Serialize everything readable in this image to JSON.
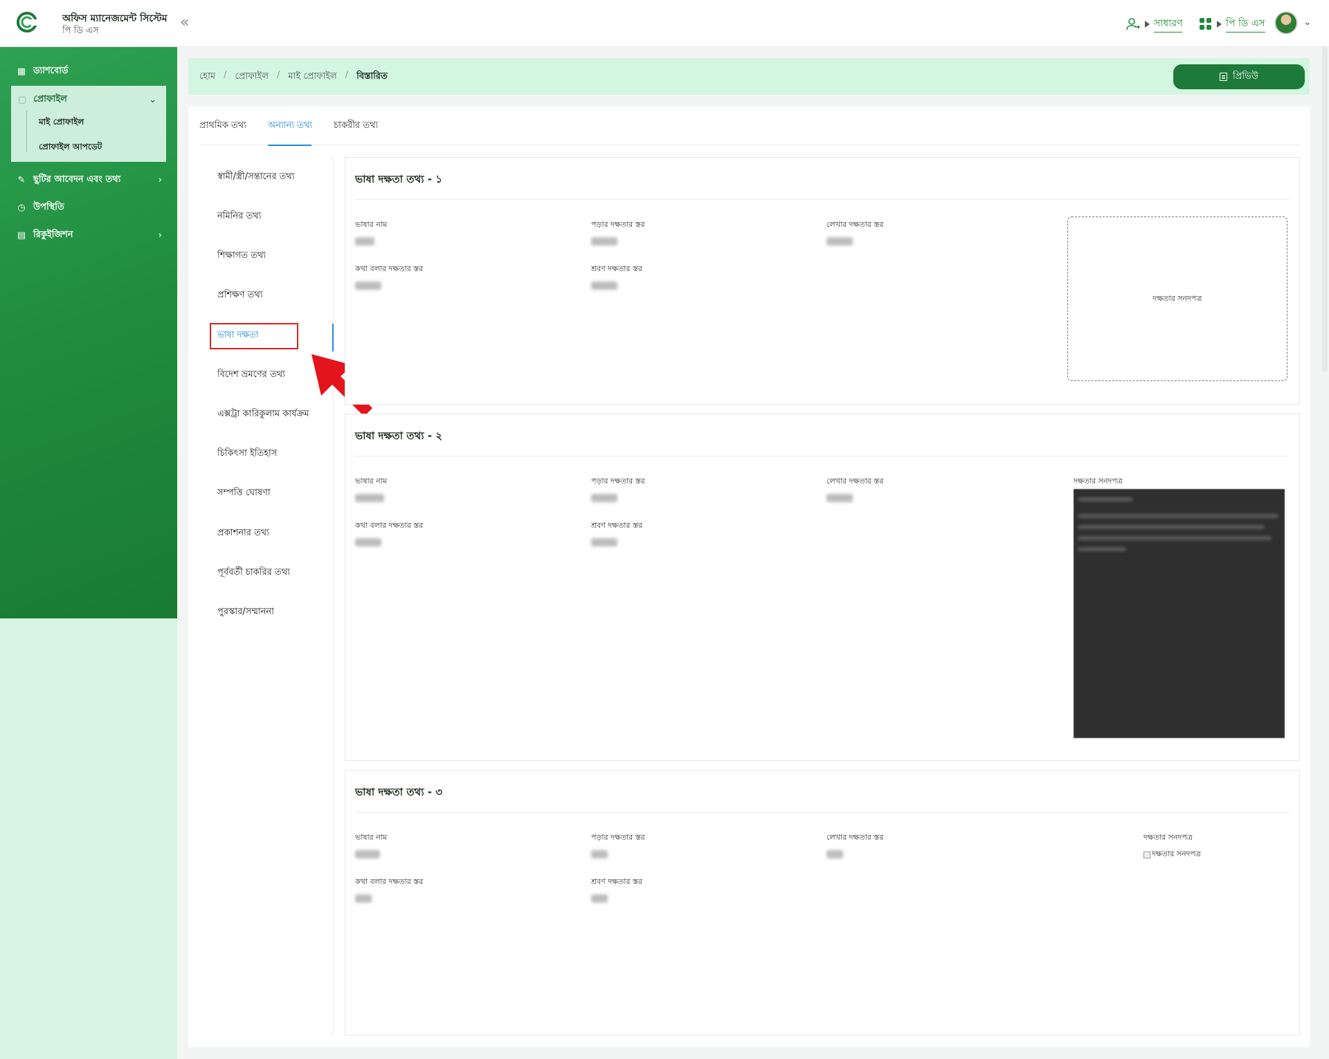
{
  "header": {
    "app_title": "অফিস ম্যানেজমেন্ট সিস্টেম",
    "app_subtitle": "পি ডি এস",
    "role_label": "সাধারণ",
    "module_label": "পি ডি এস"
  },
  "sidebar": {
    "dashboard": "ড্যাশবোর্ড",
    "profile": "প্রোফাইল",
    "my_profile": "মাই প্রোফাইল",
    "profile_update": "প্রোফাইল আপডেট",
    "leave": "ছুটির আবেদন এবং তথ্য",
    "attendance": "উপস্থিতি",
    "requisition": "রিকুইজিশন"
  },
  "breadcrumb": {
    "home": "হোম",
    "profile": "প্রোফাইল",
    "my_profile": "মাই প্রোফাইল",
    "details": "বিস্তারিত"
  },
  "preview_button": "প্রিভিউ",
  "tabs": [
    "প্রাথমিক তথ্য",
    "অন্যান্য তথ্য",
    "চাকরীর তথ্য"
  ],
  "subnav": [
    "স্বামী/স্ত্রী/সন্তানের তথ্য",
    "নমিনির তথ্য",
    "শিক্ষাগত তথ্য",
    "প্রশিক্ষণ তথ্য",
    "ভাষা দক্ষতা",
    "বিদেশ ভ্রমণের তথ্য",
    "এক্সট্রা কারিকুলাম কার্যক্রম",
    "চিকিৎসা ইতিহাস",
    "সম্পত্তি ঘোষণা",
    "প্রকাশনার তথ্য",
    "পূর্ববর্তী চাকরির তথ্য",
    "পুরস্কার/সম্মাননা"
  ],
  "language_cards": [
    {
      "title": "ভাষা দক্ষতা তথ্য - ১",
      "labels": {
        "language": "ভাষার নাম",
        "reading": "পড়ার দক্ষতার স্তর",
        "writing": "লেখার দক্ষতার স্তর",
        "speaking": "কথা বলার দক্ষতার স্তর",
        "listening": "শ্রবণ দক্ষতার স্তর"
      },
      "certificate": "দক্ষতার সনদপত্র"
    },
    {
      "title": "ভাষা দক্ষতা তথ্য - ২",
      "labels": {
        "language": "ভাষার নাম",
        "reading": "পড়ার দক্ষতার স্তর",
        "writing": "লেখার দক্ষতার স্তর",
        "speaking": "কথা বলার দক্ষতার স্তর",
        "listening": "শ্রবণ দক্ষতার স্তর"
      },
      "certificate": "দক্ষতার সনদপত্র"
    },
    {
      "title": "ভাষা দক্ষতা তথ্য - ৩",
      "labels": {
        "language": "ভাষার নাম",
        "reading": "পড়ার দক্ষতার স্তর",
        "writing": "লেখার দক্ষতার স্তর",
        "speaking": "কথা বলার দক্ষতার স্তর",
        "listening": "শ্রবণ দক্ষতার স্তর"
      },
      "certificate": "দক্ষতার সনদপত্র",
      "certificate_alt": "দক্ষতার সনদপত্র"
    }
  ],
  "colors": {
    "brand_green": "#1e7a3a",
    "accent_blue": "#1e88e5",
    "highlight_red": "#e02020"
  }
}
